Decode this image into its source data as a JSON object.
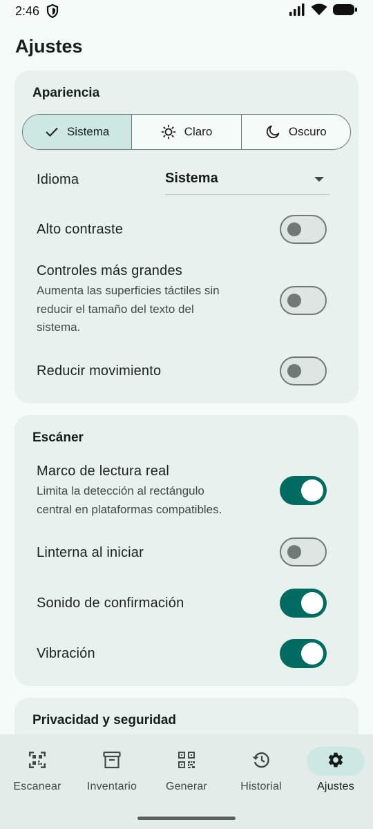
{
  "status_bar": {
    "time": "2:46"
  },
  "page": {
    "title": "Ajustes"
  },
  "appearance": {
    "title": "Apariencia",
    "theme_options": [
      "Sistema",
      "Claro",
      "Oscuro"
    ],
    "selected_theme": "Sistema",
    "language_label": "Idioma",
    "language_value": "Sistema",
    "high_contrast": {
      "label": "Alto contraste",
      "enabled": false
    },
    "larger_controls": {
      "label": "Controles más grandes",
      "description_lines": [
        "Aumenta las superficies táctiles sin",
        "reducir el tamaño del texto del",
        "sistema."
      ],
      "enabled": false
    },
    "reduce_motion": {
      "label": "Reducir movimiento",
      "enabled": false
    }
  },
  "scanner": {
    "title": "Escáner",
    "real_frame": {
      "label": "Marco de lectura real",
      "description_lines": [
        "Limita la detección al rectángulo",
        "central en plataformas compatibles."
      ],
      "enabled": true
    },
    "flashlight": {
      "label": "Linterna al iniciar",
      "enabled": false
    },
    "sound": {
      "label": "Sonido de confirmación",
      "enabled": true
    },
    "vibration": {
      "label": "Vibración",
      "enabled": true
    }
  },
  "privacy": {
    "title": "Privacidad y seguridad"
  },
  "bottom_nav": {
    "items": [
      "Escanear",
      "Inventario",
      "Generar",
      "Historial",
      "Ajustes"
    ],
    "active": "Ajustes"
  },
  "colors": {
    "accent": "#006b61",
    "selected_container": "#cde8e3",
    "card_background": "#e9f1ee",
    "page_background": "#f5fbf8"
  }
}
